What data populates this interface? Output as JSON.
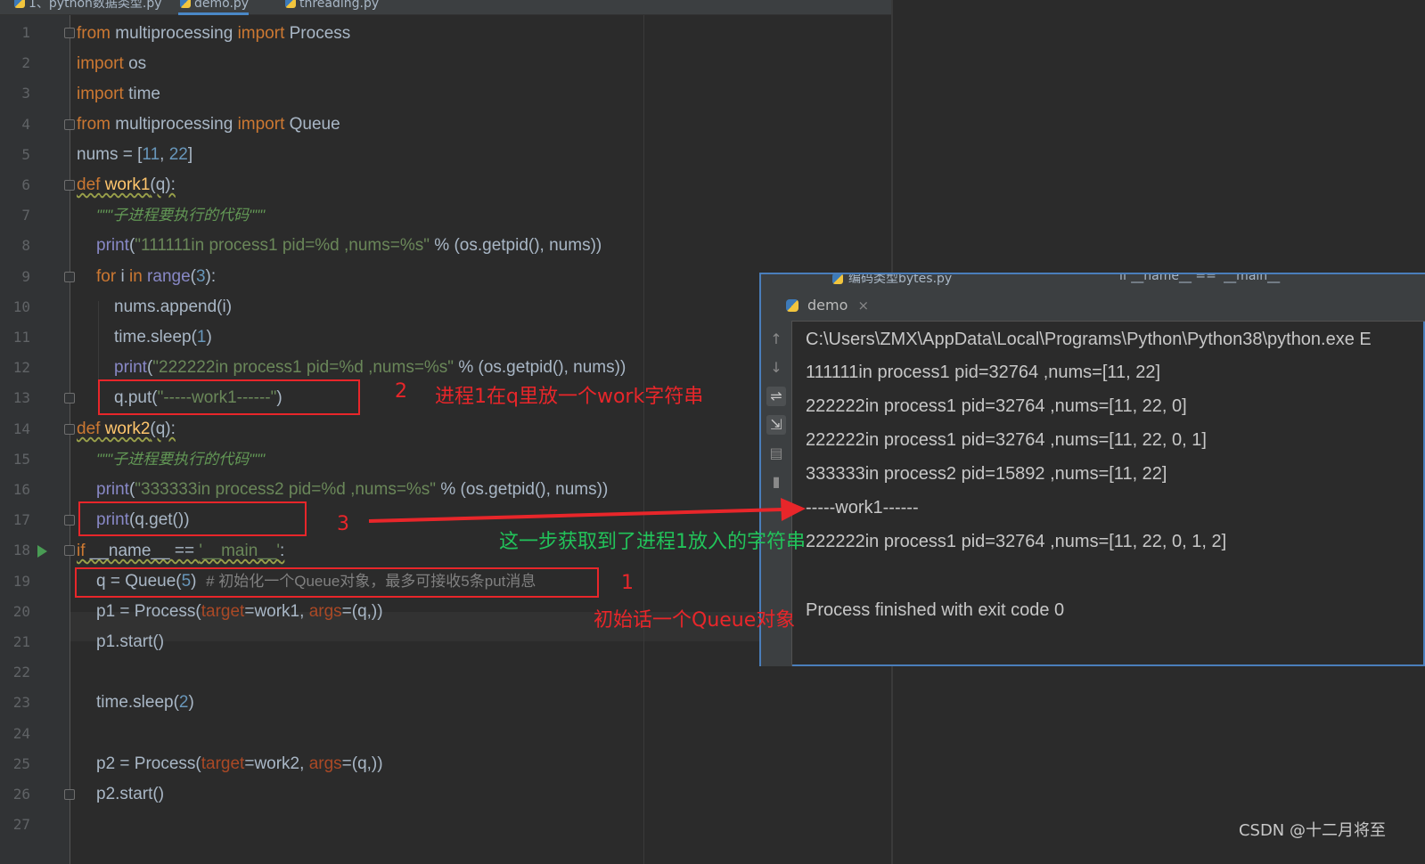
{
  "tabs": [
    {
      "label": "1、python数据类型.py",
      "active": false
    },
    {
      "label": "demo.py",
      "active": true
    },
    {
      "label": "threading.py",
      "active": false
    }
  ],
  "line_numbers": [
    "1",
    "2",
    "3",
    "4",
    "5",
    "6",
    "7",
    "8",
    "9",
    "10",
    "11",
    "12",
    "13",
    "14",
    "15",
    "16",
    "17",
    "18",
    "19",
    "20",
    "21",
    "22",
    "23",
    "24",
    "25",
    "26",
    "27"
  ],
  "code": {
    "l1_kw1": "from",
    "l1_mod": " multiprocessing ",
    "l1_kw2": "import",
    "l1_name": " Process",
    "l2_kw": "import",
    "l2_name": " os",
    "l3_kw": "import",
    "l3_name": " time",
    "l4_kw1": "from",
    "l4_mod": " multiprocessing ",
    "l4_kw2": "import",
    "l4_name": " Queue",
    "l5_a": "nums = [",
    "l5_n1": "11",
    "l5_c": ", ",
    "l5_n2": "22",
    "l5_b": "]",
    "l6_kw": "def",
    "l6_fn": " work1",
    "l6_args": "(q):",
    "l7_doc": "\"\"\"子进程要执行的代码\"\"\"",
    "l8_print": "print",
    "l8_a": "(",
    "l8_str": "\"111111in process1 pid=%d ,nums=%s\"",
    "l8_b": " % (os.getpid(), nums))",
    "l9_kw1": "for",
    "l9_a": " i ",
    "l9_kw2": "in",
    "l9_bi": " range",
    "l9_b": "(",
    "l9_n": "3",
    "l9_c": "):",
    "l10": "nums.append(i)",
    "l11_a": "time.sleep(",
    "l11_n": "1",
    "l11_b": ")",
    "l12_print": "print",
    "l12_a": "(",
    "l12_str": "\"222222in process1 pid=%d ,nums=%s\"",
    "l12_b": " % (os.getpid(), nums))",
    "l13_a": "q.put(",
    "l13_str": "\"-----work1------\"",
    "l13_b": ")",
    "l14_kw": "def",
    "l14_fn": " work2",
    "l14_args": "(q):",
    "l15_doc": "\"\"\"子进程要执行的代码\"\"\"",
    "l16_print": "print",
    "l16_a": "(",
    "l16_str": "\"333333in process2 pid=%d ,nums=%s\"",
    "l16_b": " % (os.getpid(), nums))",
    "l17_print": "print",
    "l17_a": "(q.get())",
    "l18_kw": "if",
    "l18_a": " __name__ == ",
    "l18_str": "'__main__'",
    "l18_b": ":",
    "l19_a": "q = Queue(",
    "l19_n": "5",
    "l19_b": ")  ",
    "l19_cmt": "# 初始化一个Queue对象，最多可接收5条put消息",
    "l20_a": "p1 = Process(",
    "l20_p1": "target",
    "l20_b": "=work1, ",
    "l20_p2": "args",
    "l20_c": "=(q,))",
    "l21": "p1.start()",
    "l23_a": "time.sleep(",
    "l23_n": "2",
    "l23_b": ")",
    "l25_a": "p2 = Process(",
    "l25_p1": "target",
    "l25_b": "=work2, ",
    "l25_p2": "args",
    "l25_c": "=(q,))",
    "l26": "p2.start()"
  },
  "run": {
    "top_tab1": "编码类型bytes.py",
    "top_tab2": "if __name__ == '__main__'",
    "tab_label": "demo",
    "close": "×",
    "lines": [
      "C:\\Users\\ZMX\\AppData\\Local\\Programs\\Python\\Python38\\python.exe E",
      "111111in process1 pid=32764 ,nums=[11, 22]",
      "222222in process1 pid=32764 ,nums=[11, 22, 0]",
      "222222in process1 pid=32764 ,nums=[11, 22, 0, 1]",
      "333333in process2 pid=15892 ,nums=[11, 22]",
      "-----work1------",
      "222222in process1 pid=32764 ,nums=[11, 22, 0, 1, 2]",
      "Process finished with exit code 0"
    ]
  },
  "annotations": {
    "a2_num": "2",
    "a2_text": "进程1在q里放一个work字符串",
    "a3_num": "3",
    "a3_text": "这一步获取到了进程1放入的字符串",
    "a1_num": "1",
    "a1_text": "初始话一个Queue对象"
  },
  "watermark": "CSDN @十二月将至",
  "colors": {
    "keyword": "#cc7832",
    "string": "#6a8759",
    "number": "#6897bb",
    "annotation": "#e8262a",
    "annotation_green": "#22c35a"
  }
}
